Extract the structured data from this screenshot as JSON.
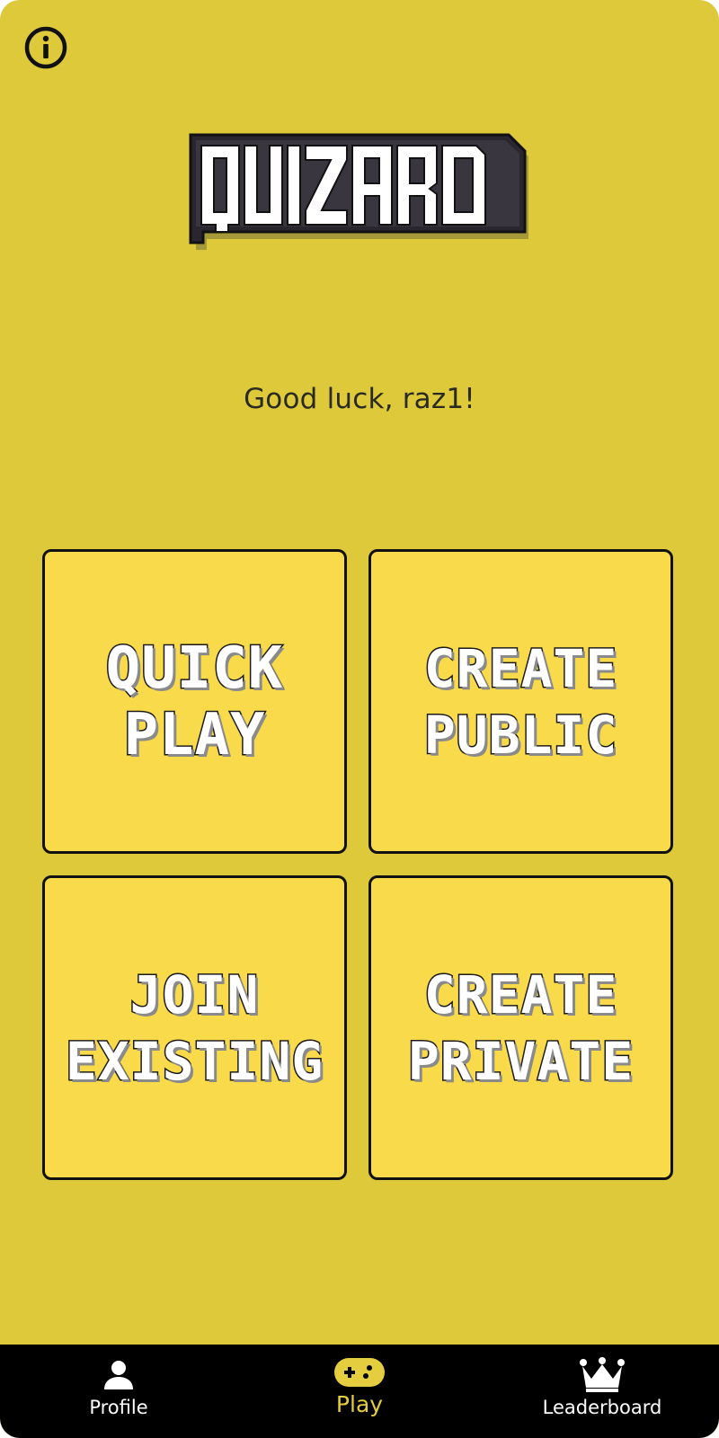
{
  "app": {
    "logo_text": "QUIZARD"
  },
  "header": {
    "info_icon": "info-icon"
  },
  "greeting": "Good luck, raz1!",
  "menu": {
    "quick_play": {
      "line1": "QUICK",
      "line2": "PLAY"
    },
    "create_public": {
      "line1": "CREATE",
      "line2": "PUBLIC"
    },
    "join_existing": {
      "line1": "JOIN",
      "line2": "EXISTING"
    },
    "create_private": {
      "line1": "CREATE",
      "line2": "PRIVATE"
    }
  },
  "nav": {
    "items": [
      {
        "label": "Profile",
        "icon": "person-icon",
        "active": false
      },
      {
        "label": "Play",
        "icon": "gamepad-icon",
        "active": true
      },
      {
        "label": "Leaderboard",
        "icon": "crown-icon",
        "active": false
      }
    ]
  },
  "colors": {
    "background": "#dec93a",
    "tile": "#f8da4a",
    "navbar": "#000000",
    "active_nav": "#e4cd3e"
  }
}
